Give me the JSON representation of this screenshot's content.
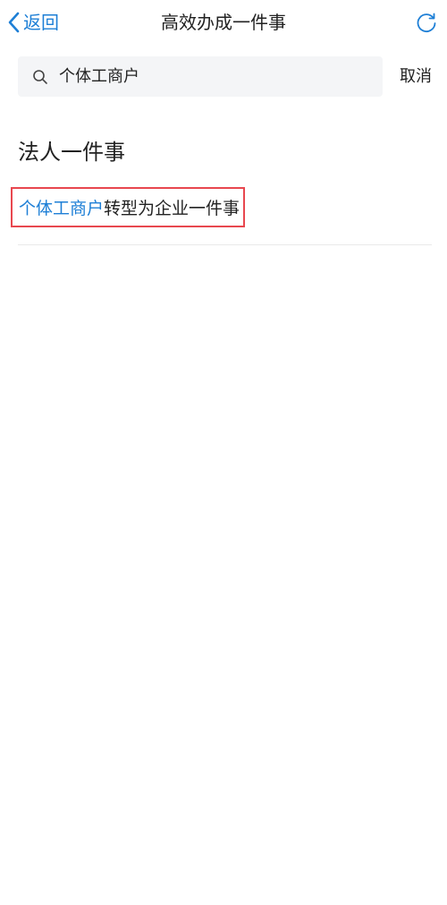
{
  "header": {
    "back_label": "返回",
    "title": "高效办成一件事",
    "back_icon": "chevron-left-icon",
    "refresh_icon": "refresh-icon"
  },
  "search": {
    "value": "个体工商户",
    "cancel_label": "取消",
    "icon": "search-icon"
  },
  "section": {
    "title": "法人一件事"
  },
  "results": [
    {
      "highlight": "个体工商户",
      "rest": "转型为企业一件事"
    }
  ],
  "colors": {
    "accent": "#1e7fd6",
    "highlight_border": "#e8474f",
    "search_bg": "#f4f5f7"
  }
}
